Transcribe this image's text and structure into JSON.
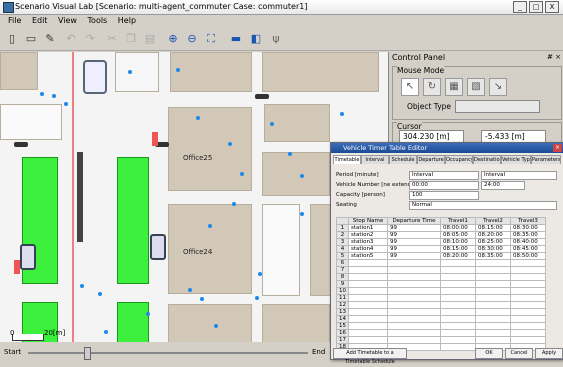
{
  "window": {
    "title": "Scenario Visual Lab [Scenario: multi-agent_commuter Case: commuter1]",
    "buttons": [
      "_",
      "□",
      "X"
    ]
  },
  "menu": [
    "File",
    "Edit",
    "View",
    "Tools",
    "Help"
  ],
  "map": {
    "buildings": [
      "Office25",
      "Office24"
    ],
    "scale_labels": [
      "0",
      "20[m]"
    ]
  },
  "statusbar": {
    "start_label": "Start",
    "end_label": "End"
  },
  "control_panel": {
    "title": "Control Panel",
    "pin": "# ×",
    "mouse_mode_label": "Mouse Mode",
    "object_type_label": "Object Type",
    "object_type_value": "",
    "cursor_label": "Cursor",
    "cursor_x": "304.230 [m]",
    "cursor_y": "-5.433 [m]"
  },
  "dialog": {
    "title": "Vehicle Timer Table Editor",
    "tabs": [
      "Timetable",
      "Interval",
      "Schedule",
      "Departure",
      "Occupancy",
      "Destination",
      "Vehicle Type",
      "Parameters"
    ],
    "fields": [
      {
        "label": "Period [minute]",
        "value": "Interval",
        "value2": "Interval"
      },
      {
        "label": "Vehicle Number [ne extend(p)?]",
        "value": "00:00",
        "value2": "24:00"
      },
      {
        "label": "Capacity [person]",
        "value": "100",
        "value2": ""
      },
      {
        "label": "Seating",
        "value": "Normal",
        "value2": ""
      }
    ],
    "table": {
      "headers": [
        "",
        "Stop Name",
        "Departure Time",
        "Travel1",
        "Travel2",
        "Travel3"
      ],
      "rows": [
        [
          "1",
          "station1",
          "99",
          "08:00:00",
          "08:15:00",
          "08:30:00"
        ],
        [
          "2",
          "station2",
          "99",
          "08:05:00",
          "08:20:00",
          "08:35:00"
        ],
        [
          "3",
          "station3",
          "99",
          "08:10:00",
          "08:25:00",
          "08:40:00"
        ],
        [
          "4",
          "station4",
          "99",
          "08:15:00",
          "08:30:00",
          "08:45:00"
        ],
        [
          "5",
          "station5",
          "99",
          "08:20:00",
          "08:35:00",
          "08:50:00"
        ],
        [
          "6",
          "",
          "",
          "",
          "",
          ""
        ],
        [
          "7",
          "",
          "",
          "",
          "",
          ""
        ],
        [
          "8",
          "",
          "",
          "",
          "",
          ""
        ],
        [
          "9",
          "",
          "",
          "",
          "",
          ""
        ],
        [
          "10",
          "",
          "",
          "",
          "",
          ""
        ],
        [
          "11",
          "",
          "",
          "",
          "",
          ""
        ],
        [
          "12",
          "",
          "",
          "",
          "",
          ""
        ],
        [
          "13",
          "",
          "",
          "",
          "",
          ""
        ],
        [
          "14",
          "",
          "",
          "",
          "",
          ""
        ],
        [
          "15",
          "",
          "",
          "",
          "",
          ""
        ],
        [
          "16",
          "",
          "",
          "",
          "",
          ""
        ],
        [
          "17",
          "",
          "",
          "",
          "",
          ""
        ],
        [
          "18",
          "",
          "",
          "",
          "",
          ""
        ]
      ]
    },
    "button_left": "Add Timetable to a Timetable Schedule",
    "button_ok": "OK",
    "button_cancel": "Cancel",
    "button_apply": "Apply"
  },
  "colors": {
    "grass": "#3df03d",
    "building": "#d2c8b8",
    "pedestrian": "#1e88e5",
    "title_bar": "#1c4a93"
  }
}
